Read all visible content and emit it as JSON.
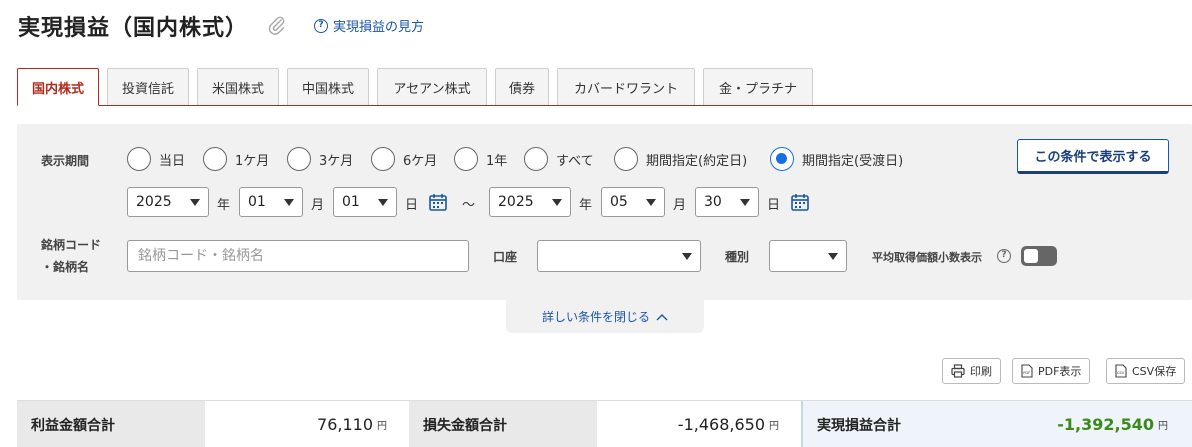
{
  "header": {
    "title": "実現損益（国内株式）",
    "help_link": "実現損益の見方"
  },
  "tabs": [
    {
      "label": "国内株式",
      "active": true
    },
    {
      "label": "投資信託"
    },
    {
      "label": "米国株式"
    },
    {
      "label": "中国株式"
    },
    {
      "label": "アセアン株式"
    },
    {
      "label": "債券"
    },
    {
      "label": "カバードワラント"
    },
    {
      "label": "金・プラチナ"
    }
  ],
  "filter": {
    "period_label": "表示期間",
    "period_options": [
      "当日",
      "1ケ月",
      "3ケ月",
      "6ケ月",
      "1年",
      "すべて",
      "期間指定(約定日)",
      "期間指定(受渡日)"
    ],
    "selected_period": "期間指定(受渡日)",
    "show_button": "この条件で表示する",
    "from": {
      "year": "2025",
      "month": "01",
      "day": "01"
    },
    "to": {
      "year": "2025",
      "month": "05",
      "day": "30"
    },
    "unit_year": "年",
    "unit_month": "月",
    "unit_day": "日",
    "tilde": "～",
    "code_label_1": "銘柄コード",
    "code_label_2": "・銘柄名",
    "code_placeholder": "銘柄コード・銘柄名",
    "account_label": "口座",
    "account_value": "",
    "kind_label": "種別",
    "kind_value": "",
    "decimal_label": "平均取得価額小数表示",
    "collapse_label": "詳しい条件を閉じる"
  },
  "actions": {
    "print": "印刷",
    "pdf": "PDF表示",
    "csv": "CSV保存"
  },
  "summary": {
    "profit_label": "利益金額合計",
    "profit_value": "76,110",
    "loss_label": "損失金額合計",
    "loss_value": "-1,468,650",
    "realized_label": "実現損益合計",
    "realized_value": "-1,392,540",
    "yen": "円"
  },
  "colors": {
    "accent_red": "#b32b1c",
    "link_blue": "#1a56a8",
    "radio_blue": "#1a6fe0",
    "gain_green": "#3a8a1a"
  }
}
